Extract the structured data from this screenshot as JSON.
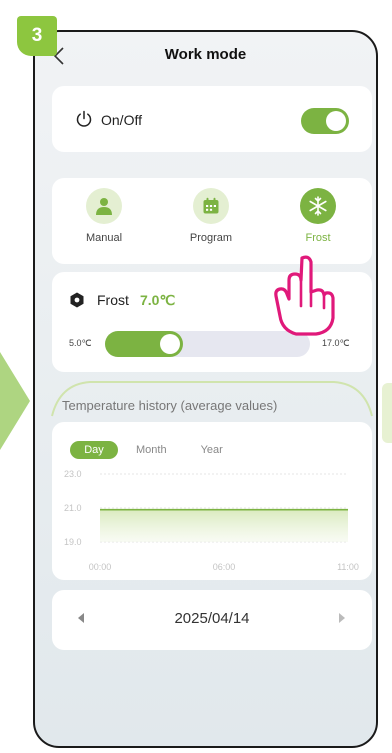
{
  "step": {
    "number": "3"
  },
  "header": {
    "title": "Work mode"
  },
  "power": {
    "label": "On/Off",
    "enabled": true
  },
  "modes": [
    {
      "label": "Manual",
      "icon": "person-icon",
      "active": false
    },
    {
      "label": "Program",
      "icon": "calendar-icon",
      "active": false
    },
    {
      "label": "Frost",
      "icon": "snowflake-icon",
      "active": true
    }
  ],
  "frost": {
    "label": "Frost",
    "value": "7.0℃",
    "min_label": "5.0℃",
    "max_label": "17.0℃",
    "level": 0.17
  },
  "history": {
    "title": "Temperature history (average values)",
    "tabs": [
      "Day",
      "Month",
      "Year"
    ],
    "active_tab": "Day"
  },
  "chart_data": {
    "type": "area",
    "y_ticks": [
      "23.0",
      "21.0",
      "19.0"
    ],
    "x_ticks": [
      "00:00",
      "06:00",
      "11:00"
    ],
    "ylim": [
      19.0,
      23.0
    ],
    "series": [
      {
        "x": [
          "00:00",
          "11:00"
        ],
        "values": [
          20.9,
          20.9
        ]
      }
    ],
    "grid": true
  },
  "date_nav": {
    "date": "2025/04/14"
  },
  "colors": {
    "accent": "#7cb342",
    "accent_light": "#e4efd2",
    "badge": "#8dc63f",
    "hand": "#e0197a"
  }
}
